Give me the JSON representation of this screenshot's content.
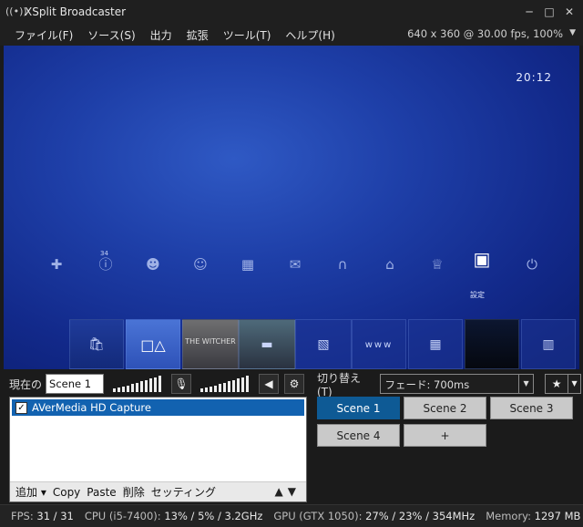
{
  "window": {
    "title": "XSplit Broadcaster",
    "controls": [
      "─",
      "□",
      "✕"
    ]
  },
  "menu": {
    "items": [
      "ファイル(F)",
      "ソース(S)",
      "出力",
      "拡張",
      "ツール(T)",
      "ヘルプ(H)"
    ],
    "resolution": "640 x 360 @ 30.00 fps, 100%"
  },
  "preview": {
    "clock": "20:12",
    "badge": "34",
    "selected_label": "設定",
    "tile_text": "THE WITCHER"
  },
  "scene_bar": {
    "current_label": "現在の",
    "scene_name": "Scene 1",
    "transition_label": "切り替え(T)",
    "transition_value": "フェード: 700ms"
  },
  "sources": {
    "items": [
      {
        "name": "AVerMedia HD Capture",
        "checked": true
      }
    ],
    "toolbar": [
      "追加 ▾",
      "Copy",
      "Paste",
      "削除",
      "セッティング"
    ]
  },
  "scenes": [
    "Scene 1",
    "Scene 2",
    "Scene 3",
    "Scene 4",
    "+"
  ],
  "status": {
    "fps_label": "FPS:",
    "fps_value": "31 / 31",
    "cpu_label": "CPU (i5-7400):",
    "cpu_value": "13% / 5% / 3.2GHz",
    "gpu_label": "GPU (GTX 1050):",
    "gpu_value": "27% / 23% / 354MHz",
    "mem_label": "Memory:",
    "mem_value": "1297 MB"
  }
}
